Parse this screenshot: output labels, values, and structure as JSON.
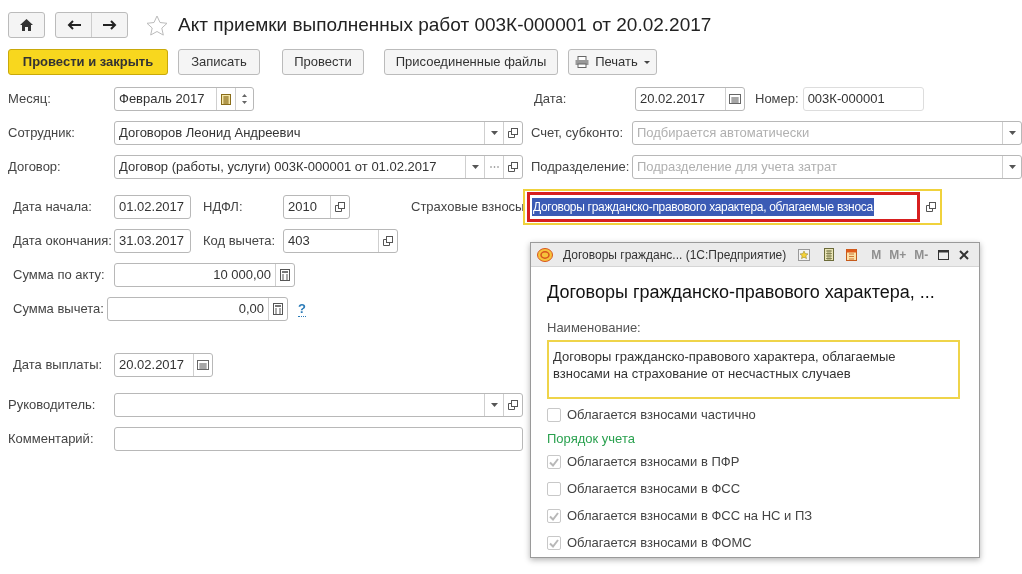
{
  "nav": {
    "favorite": false
  },
  "title": "Акт приемки выполненных работ 003К-000001 от 20.02.2017",
  "toolbar": [
    {
      "label": "Провести и закрыть",
      "kind": "primary"
    },
    {
      "label": "Записать",
      "kind": "default"
    },
    {
      "label": "Провести",
      "kind": "default"
    },
    {
      "label": "Присоединенные файлы",
      "kind": "default"
    },
    {
      "label": "Печать",
      "kind": "print-menu"
    }
  ],
  "month": {
    "label": "Месяц:",
    "value": "Февраль 2017"
  },
  "date": {
    "label": "Дата:",
    "value": "20.02.2017"
  },
  "number": {
    "label": "Номер:",
    "value": "003К-000001"
  },
  "employee": {
    "label": "Сотрудник:",
    "value": "Договоров Леонид Андреевич"
  },
  "account": {
    "label": "Счет, субконто:",
    "placeholder": "Подбирается автоматически"
  },
  "contract": {
    "label": "Договор:",
    "value": "Договор (работы, услуги) 003К-000001 от 01.02.2017"
  },
  "department": {
    "label": "Подразделение:",
    "placeholder": "Подразделение для учета затрат"
  },
  "start_date": {
    "label": "Дата начала:",
    "value": "01.02.2017"
  },
  "ndfl": {
    "label": "НДФЛ:",
    "value": "2010"
  },
  "insurance": {
    "label": "Страховые взносы",
    "value": "Договоры гражданско-правового характера, облагаемые взноса",
    "selected": true,
    "focused": true,
    "annotated": true
  },
  "end_date": {
    "label": "Дата окончания:",
    "value": "31.03.2017"
  },
  "deduction_code": {
    "label": "Код вычета:",
    "value": "403"
  },
  "act_sum": {
    "label": "Сумма по акту:",
    "value": "10 000,00"
  },
  "deduction_sum": {
    "label": "Сумма вычета:",
    "value": "0,00",
    "help": "?"
  },
  "payment_date": {
    "label": "Дата выплаты:",
    "value": "20.02.2017"
  },
  "manager": {
    "label": "Руководитель:"
  },
  "comment": {
    "label": "Комментарий:"
  },
  "popup": {
    "window_title": "Договоры гражданс... (1С:Предприятие)",
    "memory_buttons": [
      {
        "label": "M",
        "disabled": true
      },
      {
        "label": "M+",
        "disabled": true
      },
      {
        "label": "M-",
        "disabled": true
      }
    ],
    "heading": "Договоры гражданско-правового характера, ...",
    "name_label": "Наименование:",
    "name_value": "Договоры гражданско-правового характера, облагаемые взносами на страхование от несчастных случаев",
    "name_focused": true,
    "partial": {
      "label": "Облагается взносами частично",
      "checked": false
    },
    "group_title": "Порядок учета",
    "options": [
      {
        "label": "Облагается взносами в ПФР",
        "checked": true
      },
      {
        "label": "Облагается взносами в ФСС",
        "checked": false
      },
      {
        "label": "Облагается взносами в ФСС на НС и ПЗ",
        "checked": true
      },
      {
        "label": "Облагается взносами в ФОМС",
        "checked": true
      }
    ]
  }
}
